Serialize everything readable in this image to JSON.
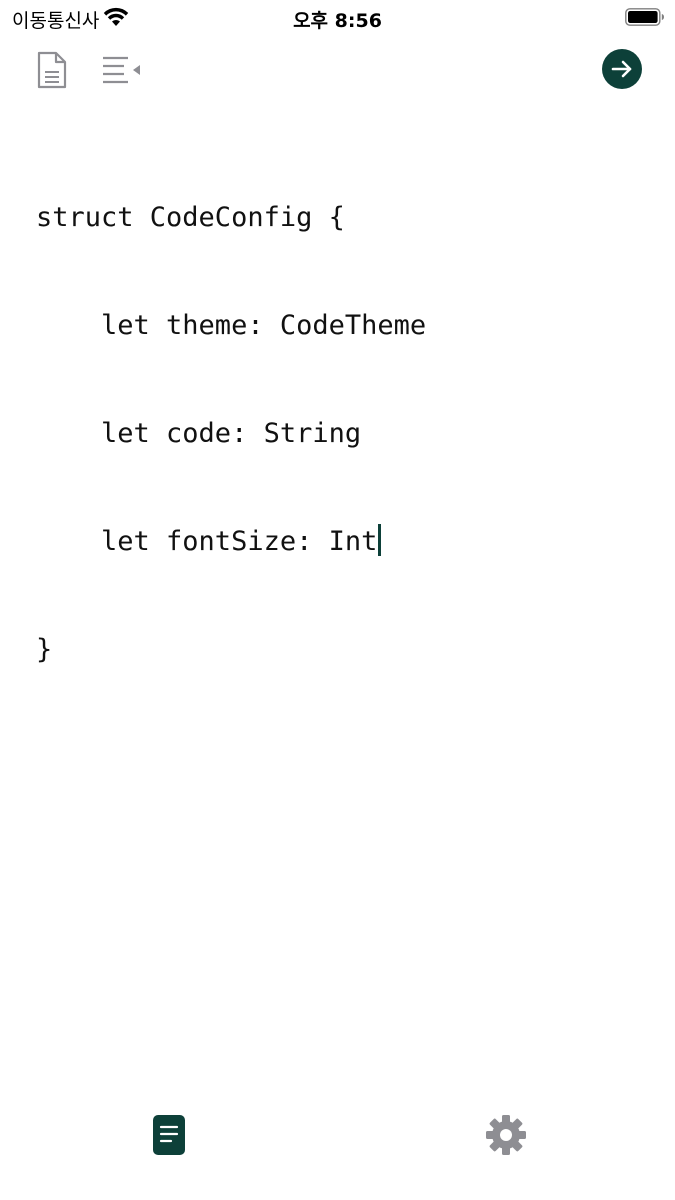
{
  "status_bar": {
    "carrier": "이동통신사",
    "time": "오후 8:56"
  },
  "toolbar": {
    "document_icon": "document-icon",
    "outdent_icon": "outdent-icon",
    "run_icon": "arrow-right-icon"
  },
  "editor": {
    "lines": [
      "struct CodeConfig {",
      "    let theme: CodeTheme",
      "    let code: String",
      "    let fontSize: Int",
      "}"
    ]
  },
  "tab_bar": {
    "editor_icon": "document-icon",
    "settings_icon": "gear-icon"
  },
  "colors": {
    "accent": "#0d4039",
    "icon_gray": "#8e8e93"
  }
}
